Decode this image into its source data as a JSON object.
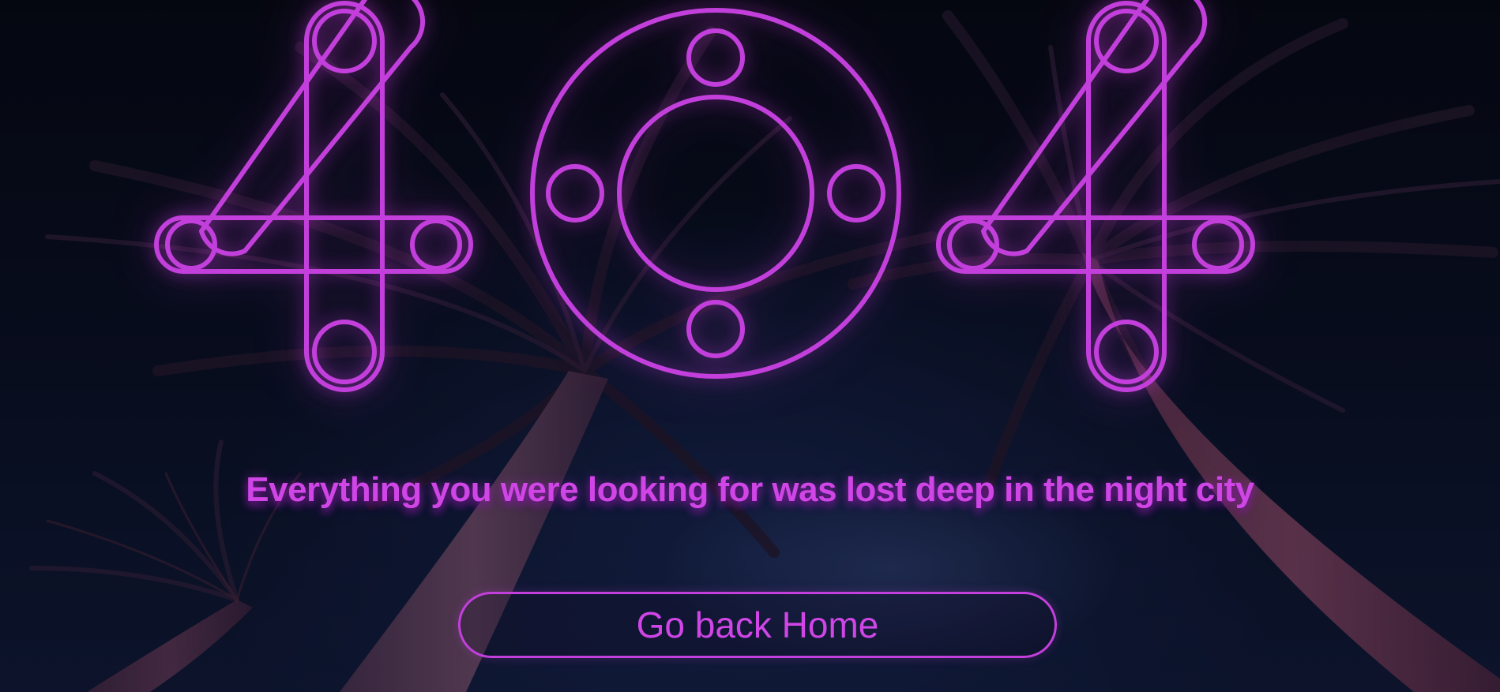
{
  "error": {
    "code_digits": [
      "4",
      "0",
      "4"
    ],
    "message": "Everything you were looking for was lost deep in the night city"
  },
  "actions": {
    "home_label": "Go back Home"
  },
  "theme": {
    "neon": "#cf45e6",
    "neon_stroke": "#c33fdc",
    "background": "#070a18"
  },
  "icons": {
    "background": "palm-trees-night-image",
    "digits": "neon-404-icon"
  }
}
